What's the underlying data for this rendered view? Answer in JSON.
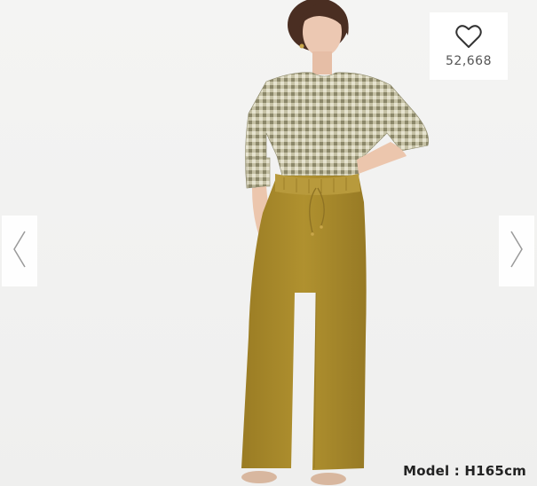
{
  "favorite": {
    "icon": "heart-outline-icon",
    "count": "52,668"
  },
  "navigation": {
    "prev_icon": "chevron-left-icon",
    "next_icon": "chevron-right-icon"
  },
  "caption": {
    "model": "Model : H165cm"
  },
  "colors": {
    "background": "#f2f2f1",
    "top_gingham": "#a7a58a",
    "pants": "#a98a2c",
    "skin": "#e9c4ad",
    "hair": "#4a2e22"
  }
}
